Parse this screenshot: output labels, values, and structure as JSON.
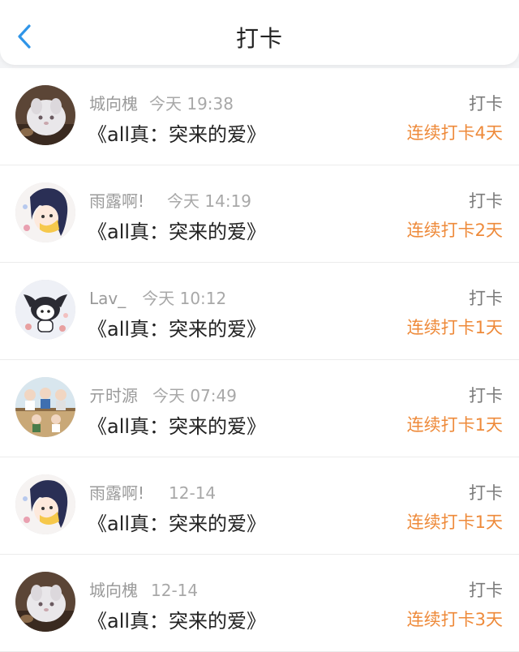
{
  "header": {
    "title": "打卡",
    "back_icon": "chevron-left-icon",
    "accent_color": "#2f95e8"
  },
  "colors": {
    "streak": "#ee8a3a",
    "background": "#f3f4f6"
  },
  "entries": [
    {
      "user": "城向槐",
      "time": "今天 19:38",
      "title": "《all真：突来的爱》",
      "action": "打卡",
      "streak": "连续打卡4天",
      "avatar": "cat-photo-avatar"
    },
    {
      "user": "雨露啊!",
      "time": "今天 14:19",
      "title": "《all真：突来的爱》",
      "action": "打卡",
      "streak": "连续打卡2天",
      "avatar": "anime-girl-avatar"
    },
    {
      "user": "Lav_",
      "time": "今天 10:12",
      "title": "《all真：突来的爱》",
      "action": "打卡",
      "streak": "连续打卡1天",
      "avatar": "kuromi-avatar"
    },
    {
      "user": "亓时源",
      "time": "今天 07:49",
      "title": "《all真：突来的爱》",
      "action": "打卡",
      "streak": "连续打卡1天",
      "avatar": "cartoon-group-avatar"
    },
    {
      "user": "雨露啊!",
      "time": "12-14",
      "title": "《all真：突来的爱》",
      "action": "打卡",
      "streak": "连续打卡1天",
      "avatar": "anime-girl-avatar"
    },
    {
      "user": "城向槐",
      "time": "12-14",
      "title": "《all真：突来的爱》",
      "action": "打卡",
      "streak": "连续打卡3天",
      "avatar": "cat-photo-avatar"
    }
  ]
}
